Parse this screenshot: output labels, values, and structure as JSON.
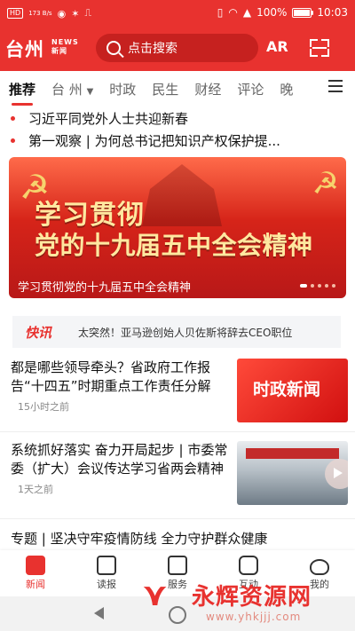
{
  "status_bar": {
    "hd_badge": "HD",
    "speed": "173 B/s",
    "battery": "100%",
    "time": "10:03"
  },
  "app_bar": {
    "logo_main": "台州",
    "logo_sub_en": "NEWS",
    "logo_sub_cn": "新闻",
    "search_placeholder": "点击搜索",
    "ar_label": "AR"
  },
  "tabs": [
    "推荐",
    "台 州",
    "时政",
    "民生",
    "财经",
    "评论",
    "晚"
  ],
  "headlines": [
    "习近平同党外人士共迎新春",
    "第一观察 | 为何总书记把知识产权保护提..."
  ],
  "banner": {
    "line1": "学习贯彻",
    "line2": "党的十九届五中全会精神",
    "caption": "学习贯彻党的十九届五中全会精神"
  },
  "kuaixun": {
    "label": "快讯",
    "text": "太突然！亚马逊创始人贝佐斯将辞去CEO职位"
  },
  "articles": [
    {
      "title": "都是哪些领导牵头？省政府工作报告“十四五”时期重点工作责任分解",
      "meta": "15小时之前",
      "thumb_text": "时政新闻"
    },
    {
      "title": "系统抓好落实 奋力开局起步 | 市委常委（扩大）会议传达学习省两会精神",
      "meta": "1天之前"
    }
  ],
  "special": "专题 | 坚决守牢疫情防线 全力守护群众健康",
  "bottom_nav": [
    "新闻",
    "读报",
    "服务",
    "互动",
    "我的"
  ],
  "watermark": {
    "brand": "永辉资源网",
    "url": "www.yhkjjj.com"
  },
  "colors": {
    "brand_red": "#e8322f"
  }
}
